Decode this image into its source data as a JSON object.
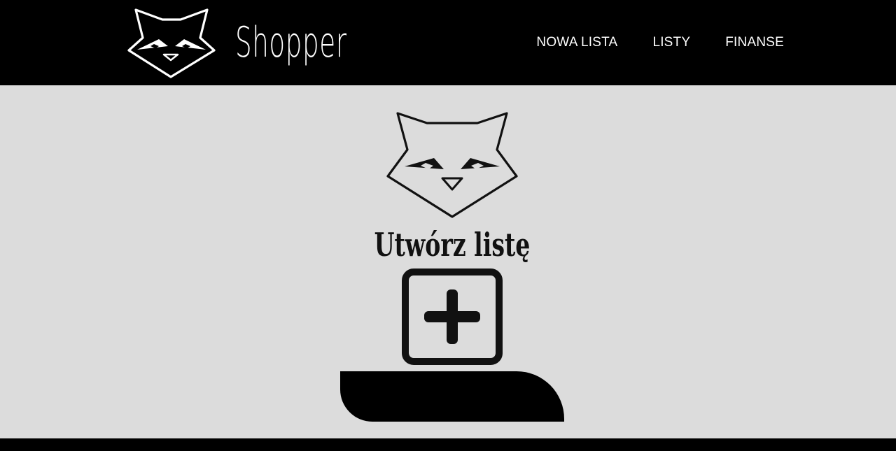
{
  "header": {
    "brand_name": "Shopper",
    "logo_icon": "raccoon-face-icon"
  },
  "nav": {
    "items": [
      {
        "label": "NOWA LISTA"
      },
      {
        "label": "LISTY"
      },
      {
        "label": "FINANSE"
      }
    ]
  },
  "main": {
    "logo_icon": "raccoon-face-icon",
    "title": "Utwórz listę",
    "add_button_icon": "plus-square-icon"
  },
  "colors": {
    "header_bg": "#000000",
    "page_bg": "#dcdcdc",
    "text_light": "#ffffff",
    "text_dark": "#111111"
  }
}
